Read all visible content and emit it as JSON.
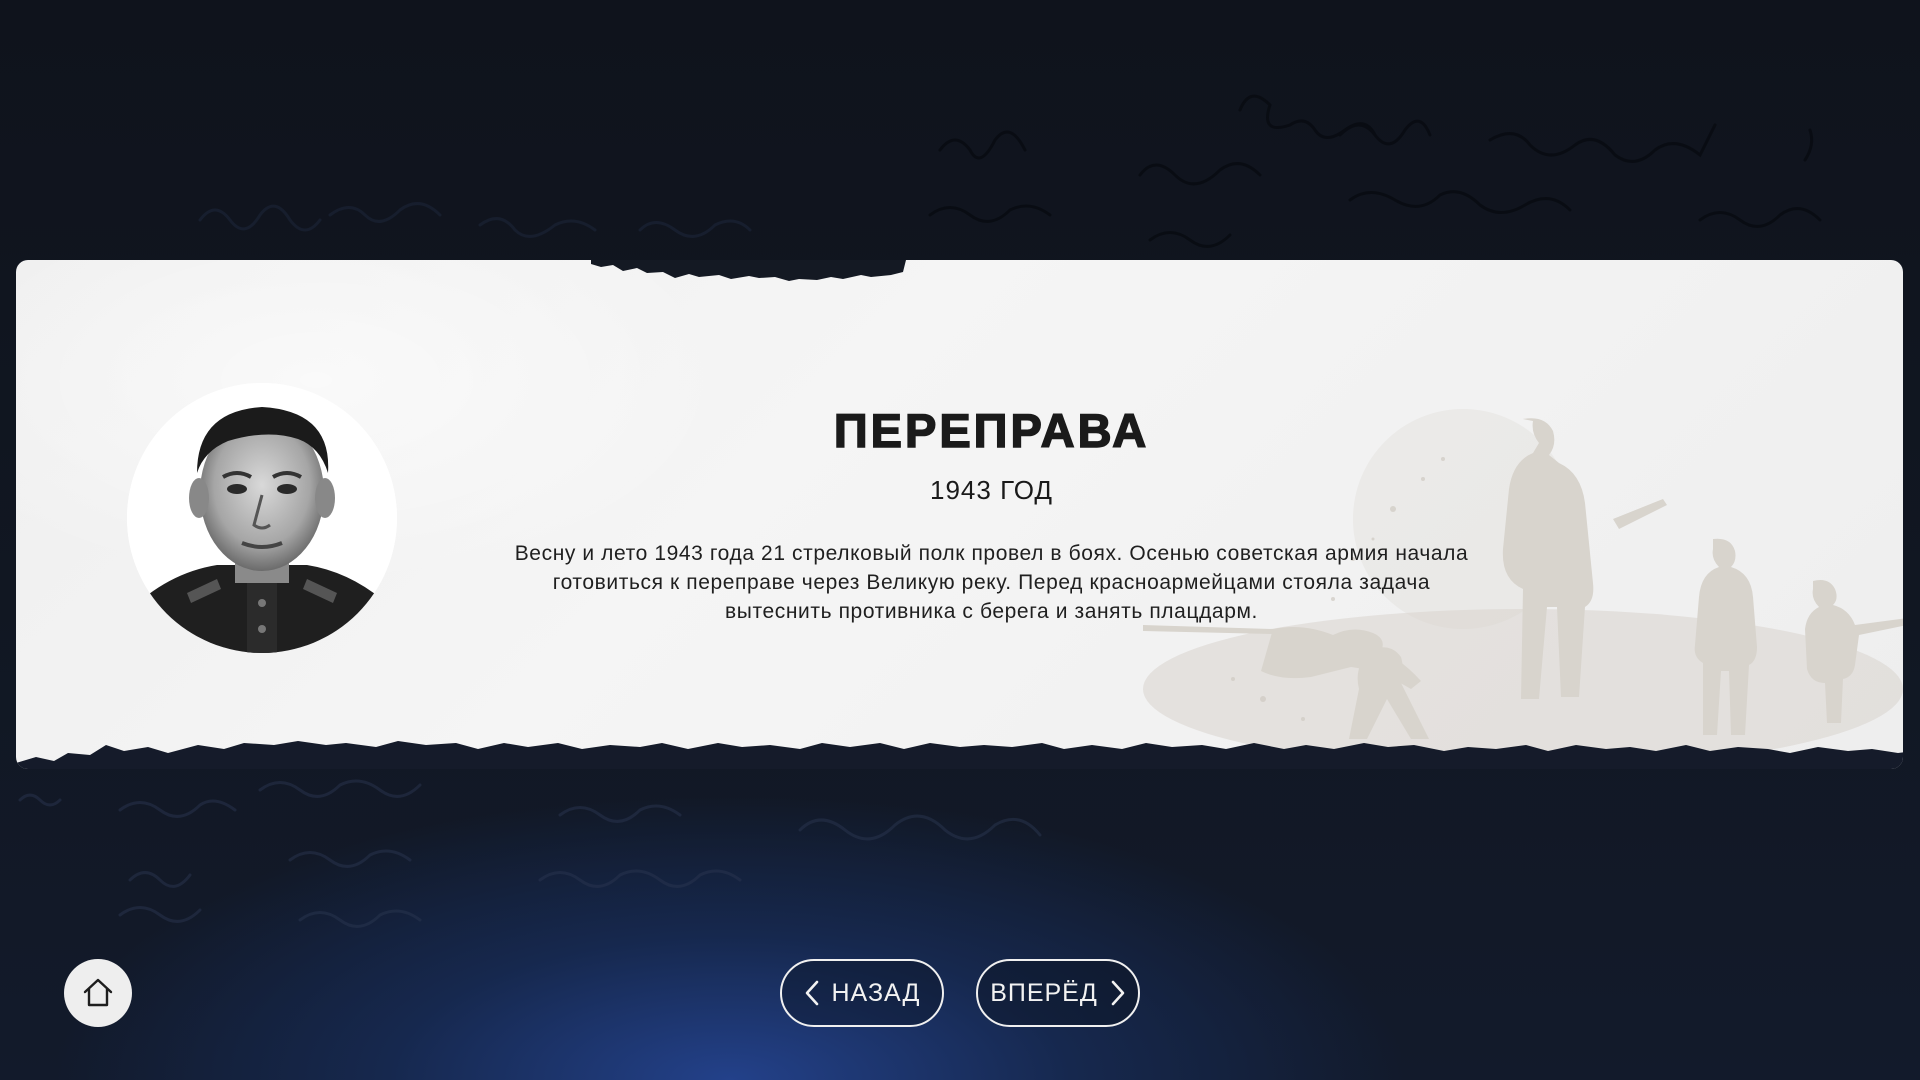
{
  "slide": {
    "title": "ПЕРЕПРАВА",
    "year": "1943 ГОД",
    "body": "Весну и лето 1943 года 21 стрелковый полк провел в боях. Осенью советская армия начала готовиться к переправе через Великую реку. Перед красноармейцами стояла задача вытеснить противника с берега и занять плацдарм."
  },
  "navigation": {
    "back_label": "НАЗАД",
    "forward_label": "ВПЕРЁД"
  },
  "icons": {
    "home": "home-icon",
    "back": "chevron-left-icon",
    "forward": "chevron-right-icon"
  },
  "colors": {
    "background": "#111722",
    "glow": "#23418a",
    "card": "#f2f2f2",
    "text": "#1a1a1a",
    "button_border": "#f0f0f0",
    "silhouette": "#d8d4cd"
  }
}
